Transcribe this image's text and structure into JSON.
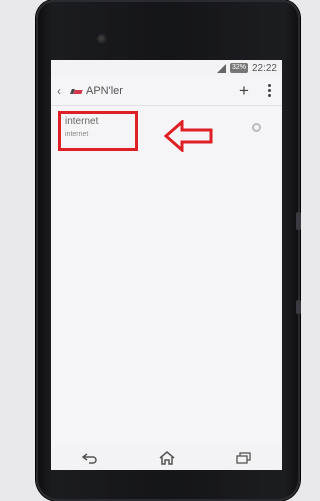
{
  "statusbar": {
    "battery": "32%",
    "time": "22:22"
  },
  "actionbar": {
    "back_icon": "back-icon",
    "title": "APN'ler",
    "add_label": "+",
    "more_icon": "more-icon"
  },
  "apn_list": [
    {
      "name": "internet",
      "apn": "internet",
      "selected": false
    }
  ],
  "annotation": {
    "color": "#e01e25"
  },
  "navbar": {
    "icons": [
      "back-nav-icon",
      "home-icon",
      "recent-apps-icon"
    ]
  }
}
